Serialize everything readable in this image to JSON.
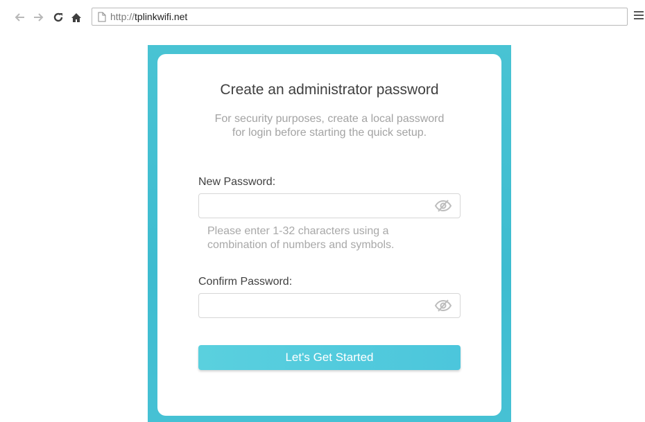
{
  "browser": {
    "url_prefix": "http://",
    "url_host": "tplinkwifi.net"
  },
  "setup": {
    "title": "Create an administrator password",
    "subtitle_line1": "For security purposes, create a local password",
    "subtitle_line2": "for login before starting the quick setup.",
    "new_password_label": "New Password:",
    "new_password_value": "",
    "hint_line1": "Please enter 1-32 characters using a",
    "hint_line2": "combination of numbers and symbols.",
    "confirm_password_label": "Confirm Password:",
    "confirm_password_value": "",
    "submit_label": "Let's Get Started"
  },
  "colors": {
    "accent": "#4cc6dc",
    "frame": "#3dbcd0"
  },
  "icons": [
    "back-icon",
    "forward-icon",
    "reload-icon",
    "home-icon",
    "page-icon",
    "menu-icon",
    "eye-slash-icon"
  ]
}
